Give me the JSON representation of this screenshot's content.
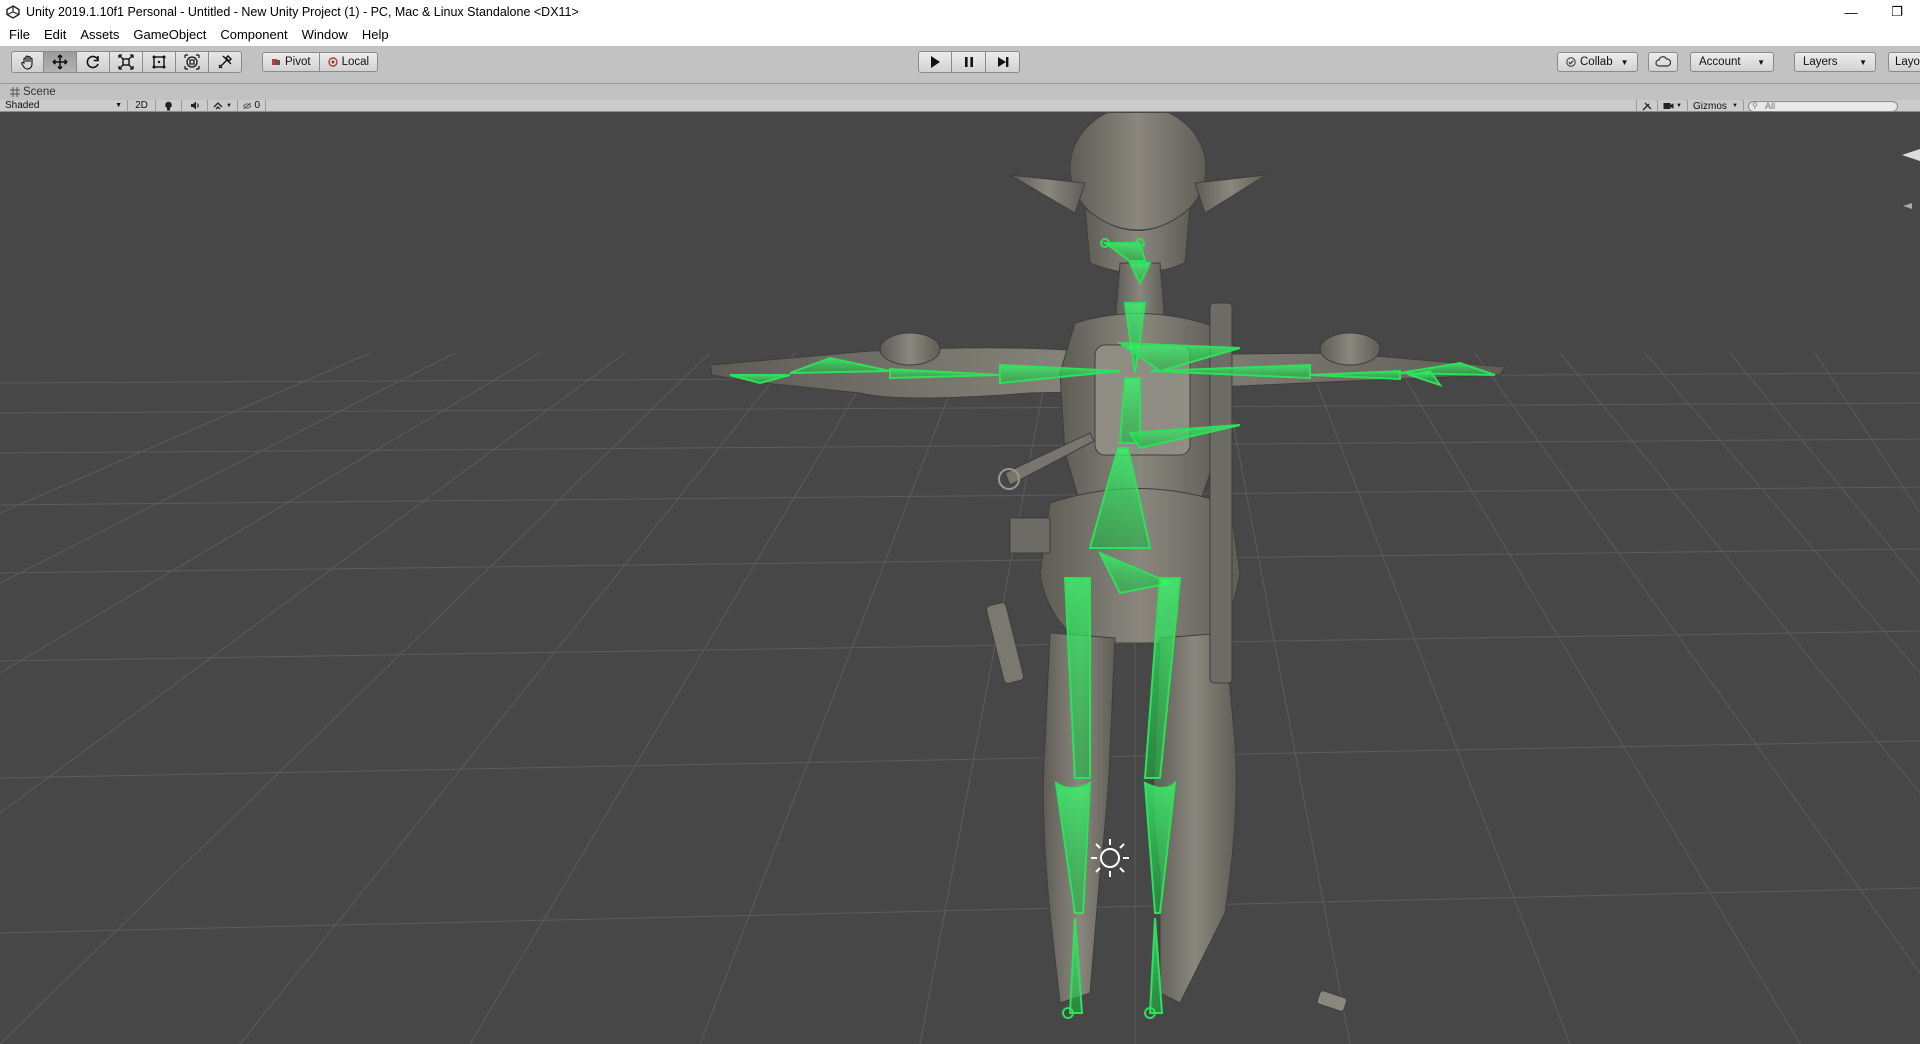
{
  "window": {
    "title": "Unity 2019.1.10f1 Personal - Untitled - New Unity Project (1) - PC, Mac & Linux Standalone <DX11>",
    "minimize": "—",
    "restore": "❐"
  },
  "menu": [
    "File",
    "Edit",
    "Assets",
    "GameObject",
    "Component",
    "Window",
    "Help"
  ],
  "toolbar": {
    "transform_tools": [
      "hand-icon",
      "move-icon",
      "rotate-icon",
      "scale-icon",
      "rect-icon",
      "transform-icon",
      "custom-tool-icon"
    ],
    "active_tool": "move-icon",
    "pivot_label": "Pivot",
    "local_label": "Local",
    "collab_label": "Collab",
    "account_label": "Account",
    "layers_label": "Layers",
    "layout_label": "Layo"
  },
  "scene_tab": {
    "label": "Scene"
  },
  "scene_toolbar": {
    "shading_mode": "Shaded",
    "mode_2d": "2D",
    "hidden_count": "0",
    "gizmos_label": "Gizmos",
    "search_placeholder": "All"
  },
  "colors": {
    "scene_bg": "#474747",
    "grid": "#5a5a5a",
    "bone": "#2ee05a",
    "model": "#7c7a72",
    "toolbar_bg": "#c2c2c2"
  }
}
